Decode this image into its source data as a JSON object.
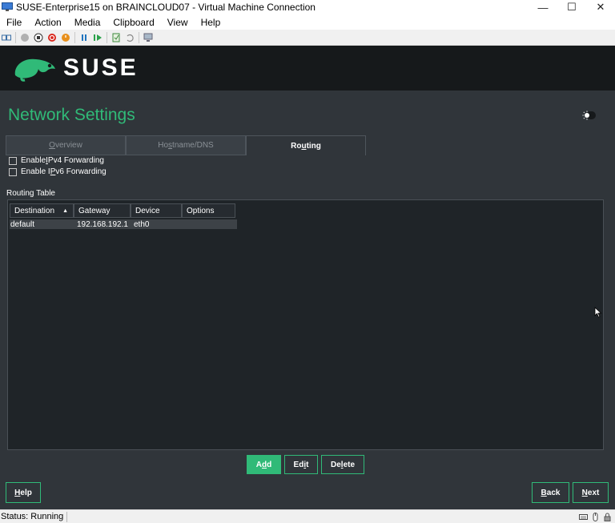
{
  "window": {
    "title": "SUSE-Enterprise15 on BRAINCLOUD07 - Virtual Machine Connection",
    "minimize_glyph": "—",
    "maximize_glyph": "☐",
    "close_glyph": "✕"
  },
  "menu": [
    "File",
    "Action",
    "Media",
    "Clipboard",
    "View",
    "Help"
  ],
  "toolbar_icons": [
    "ctrl-alt-del-icon",
    "start-icon",
    "turn-off-icon",
    "shutdown-icon",
    "power-icon",
    "pause-icon",
    "resume-icon",
    "checkpoint-icon",
    "revert-icon",
    "enhanced-session-icon"
  ],
  "brand": {
    "name": "SUSE",
    "accent": "#30ba78"
  },
  "page": {
    "title": "Network Settings"
  },
  "tabs": [
    {
      "pre": "",
      "key": "O",
      "post": "verview",
      "active": false
    },
    {
      "pre": "Ho",
      "key": "s",
      "post": "tname/DNS",
      "active": false
    },
    {
      "pre": "Ro",
      "key": "u",
      "post": "ting",
      "active": true
    }
  ],
  "options": {
    "ipv4": {
      "pre": "Enable ",
      "key": "I",
      "post": "Pv4 Forwarding",
      "checked": false
    },
    "ipv6": {
      "pre": "Enable I",
      "key": "P",
      "post": "v6 Forwarding",
      "checked": false
    }
  },
  "routing": {
    "label": "Routing Table",
    "columns": [
      "Destination",
      "Gateway",
      "Device",
      "Options"
    ],
    "sort_indicator": "▲",
    "rows": [
      {
        "destination": "default",
        "gateway": "192.168.192.1",
        "device": "eth0",
        "options": ""
      }
    ]
  },
  "actions": {
    "add": {
      "pre": "A",
      "key": "d",
      "post": "d"
    },
    "edit": {
      "pre": "Ed",
      "key": "i",
      "post": "t"
    },
    "delete": {
      "pre": "De",
      "key": "l",
      "post": "ete"
    }
  },
  "footer": {
    "help": {
      "pre": "",
      "key": "H",
      "post": "elp"
    },
    "back": {
      "pre": "",
      "key": "B",
      "post": "ack"
    },
    "next": {
      "pre": "",
      "key": "N",
      "post": "ext"
    }
  },
  "status": {
    "text": "Status: Running"
  }
}
